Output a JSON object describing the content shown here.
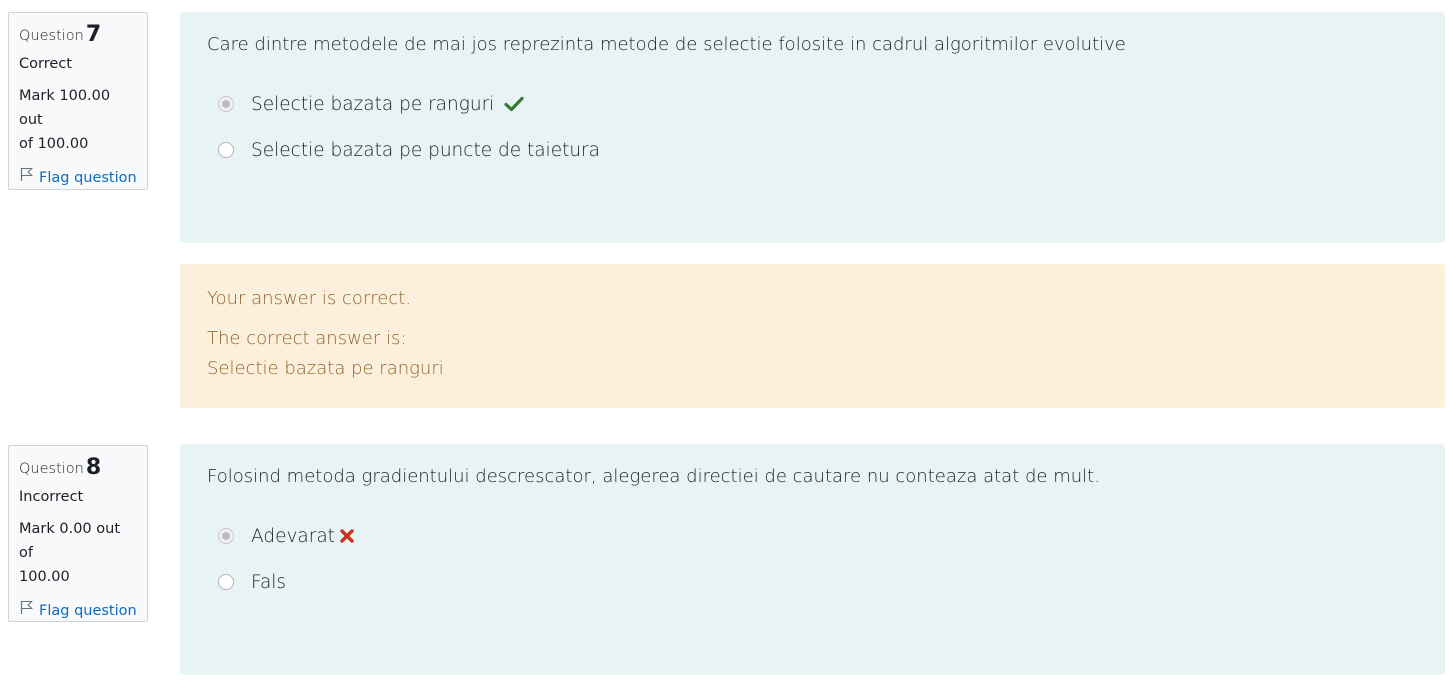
{
  "questions": [
    {
      "label": "Question",
      "number": "7",
      "state": "Correct",
      "grade_line1": "Mark 100.00 out",
      "grade_line2": "of 100.00",
      "flag_label": "Flag question",
      "text": "Care dintre metodele de mai jos reprezinta metode de selectie folosite in cadrul algoritmilor evolutive",
      "answers": [
        {
          "label": "Selectie bazata pe ranguri",
          "selected": true,
          "mark": "check-icon"
        },
        {
          "label": "Selectie bazata pe puncte de taietura",
          "selected": false,
          "mark": ""
        }
      ],
      "feedback": {
        "general": "Your answer is correct.",
        "right_answer_intro": "The correct answer is:",
        "right_answer": "Selectie bazata pe ranguri"
      }
    },
    {
      "label": "Question",
      "number": "8",
      "state": "Incorrect",
      "grade_line1": "Mark 0.00 out of",
      "grade_line2": "100.00",
      "flag_label": "Flag question",
      "text": "Folosind metoda gradientului descrescator, alegerea directiei de cautare nu conteaza atat de mult.",
      "answers": [
        {
          "label": "Adevarat",
          "selected": true,
          "mark": "cross-icon"
        },
        {
          "label": "Fals",
          "selected": false,
          "mark": ""
        }
      ]
    }
  ],
  "colors": {
    "content_bg": "#e7f3f5",
    "feedback_bg": "#fcefdc",
    "feedback_text": "#8e662e",
    "link": "#0f6cbf",
    "correct": "#357a32",
    "incorrect": "#ca3120"
  }
}
